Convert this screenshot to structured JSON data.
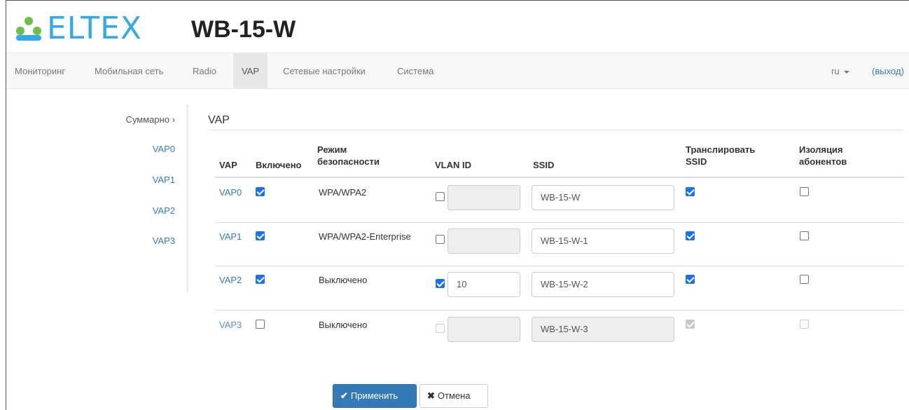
{
  "header": {
    "logo_text": "ELTEX",
    "device_title": "WB-15-W"
  },
  "nav": {
    "items": [
      {
        "label": "Мониторинг"
      },
      {
        "label": "Мобильная сеть"
      },
      {
        "label": "Radio"
      },
      {
        "label": "VAP",
        "active": true
      },
      {
        "label": "Сетевые настройки"
      },
      {
        "label": "Система"
      }
    ],
    "lang": "ru",
    "logout": "(выход)"
  },
  "sidebar": {
    "items": [
      {
        "label": "Суммарно ›"
      },
      {
        "label": "VAP0"
      },
      {
        "label": "VAP1"
      },
      {
        "label": "VAP2"
      },
      {
        "label": "VAP3"
      }
    ]
  },
  "section": {
    "title": "VAP"
  },
  "table": {
    "headers": {
      "vap": "VAP",
      "enabled": "Включено",
      "security_l1": "Режим",
      "security_l2": "безопасности",
      "vlan": "VLAN ID",
      "ssid": "SSID",
      "broadcast_l1": "Транслировать",
      "broadcast_l2": "SSID",
      "isolation_l1": "Изоляция",
      "isolation_l2": "абонентов"
    },
    "rows": [
      {
        "vap": "VAP0",
        "enabled": true,
        "security": "WPA/WPA2",
        "vlan_enabled": false,
        "vlan_id": "",
        "ssid": "WB-15-W",
        "broadcast": true,
        "isolation": false
      },
      {
        "vap": "VAP1",
        "enabled": true,
        "security": "WPA/WPA2-Enterprise",
        "vlan_enabled": false,
        "vlan_id": "",
        "ssid": "WB-15-W-1",
        "broadcast": true,
        "isolation": false
      },
      {
        "vap": "VAP2",
        "enabled": true,
        "security": "Выключено",
        "vlan_enabled": true,
        "vlan_id": "10",
        "ssid": "WB-15-W-2",
        "broadcast": true,
        "isolation": false
      },
      {
        "vap": "VAP3",
        "enabled": false,
        "security": "Выключено",
        "vlan_enabled": false,
        "vlan_id": "",
        "ssid": "WB-15-W-3",
        "broadcast": true,
        "isolation": false
      }
    ]
  },
  "buttons": {
    "apply": "Применить",
    "cancel": "Отмена"
  },
  "icons": {
    "apply": "check-icon",
    "cancel": "x-icon"
  },
  "colors": {
    "brand": "#35a9e6",
    "brand_green": "#6cc04a",
    "link": "#337ab7",
    "primary_button": "#337ab7",
    "checkbox_checked": "#1a73e8"
  }
}
